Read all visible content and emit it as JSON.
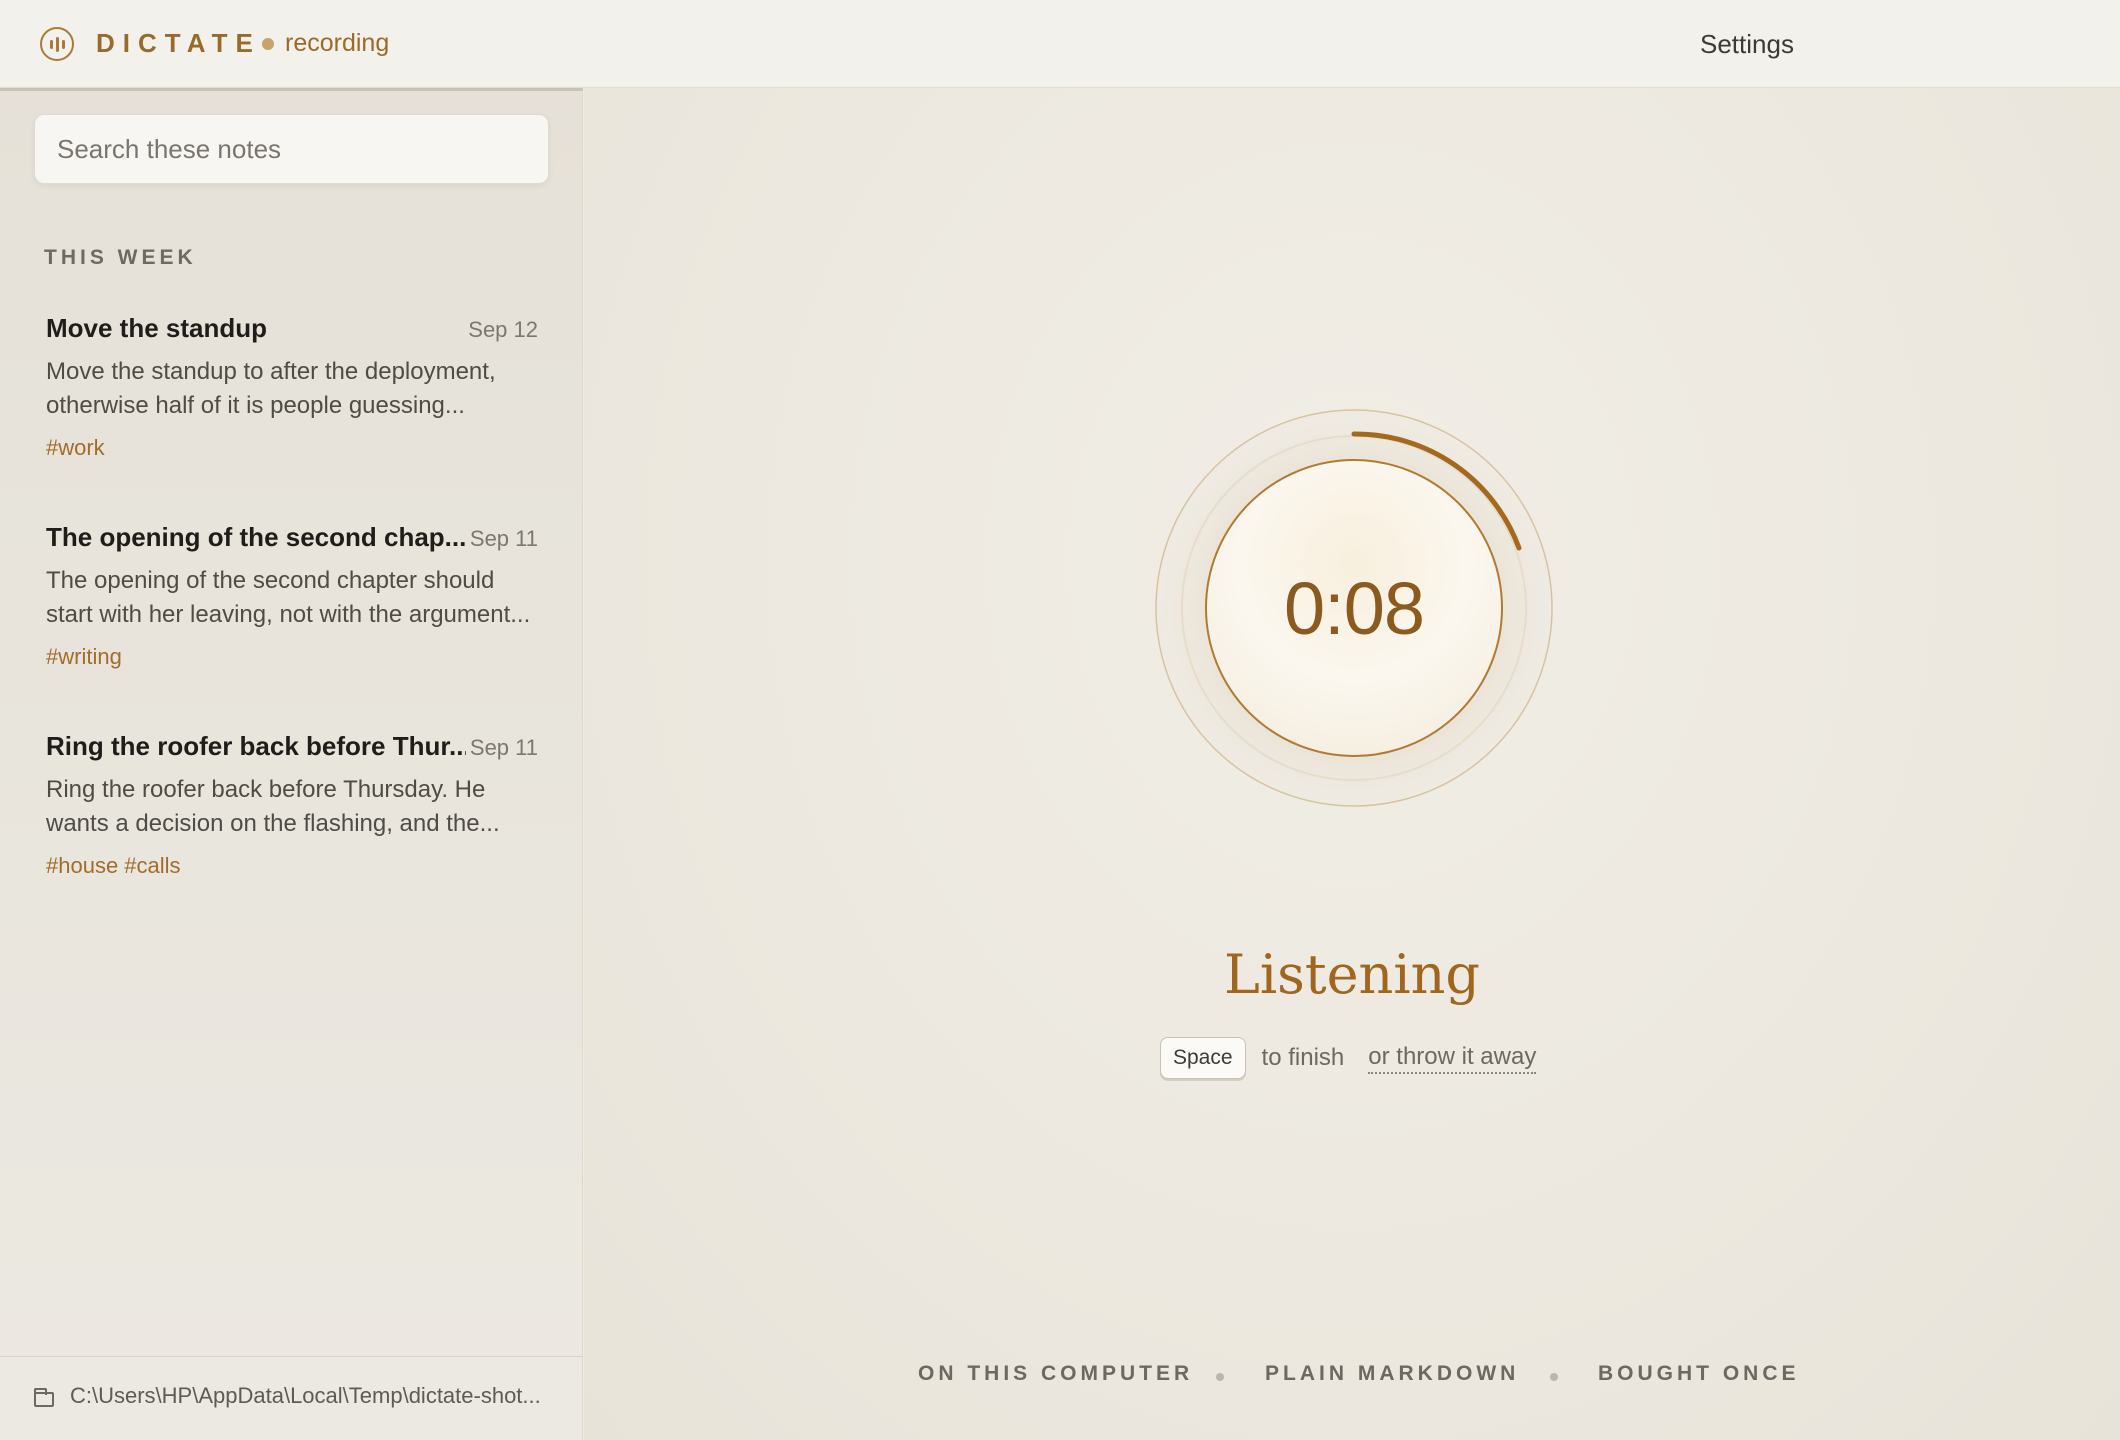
{
  "app": {
    "brand": "DICTATE",
    "status_label": "recording"
  },
  "header": {
    "settings_label": "Settings"
  },
  "sidebar": {
    "search_placeholder": "Search these notes",
    "section_label": "THIS WEEK",
    "notes": [
      {
        "title": "Move the standup",
        "date": "Sep 12",
        "excerpt": "Move the standup to after the deployment, otherwise half of it is people guessing...",
        "tags": "#work"
      },
      {
        "title": "The opening of the second chap...",
        "date": "Sep 11",
        "excerpt": "The opening of the second chapter should start with her leaving, not with the argument...",
        "tags": "#writing"
      },
      {
        "title": "Ring the roofer back before Thur...",
        "date": "Sep 11",
        "excerpt": "Ring the roofer back before Thursday. He wants a decision on the flashing, and the...",
        "tags": "#house #calls"
      }
    ],
    "folder_icon": "folder-icon",
    "path": "C:\\Users\\HP\\AppData\\Local\\Temp\\dictate-shot..."
  },
  "recorder": {
    "timer": "0:08",
    "status": "Listening",
    "key": "Space",
    "finish_text": "to finish",
    "discard_text": "or throw it away"
  },
  "footer": {
    "features": [
      "ON THIS COMPUTER",
      "PLAIN MARKDOWN",
      "BOUGHT ONCE"
    ]
  },
  "colors": {
    "accent": "#a0661e",
    "background": "#efece5",
    "sidebar": "#e8e4dc"
  }
}
